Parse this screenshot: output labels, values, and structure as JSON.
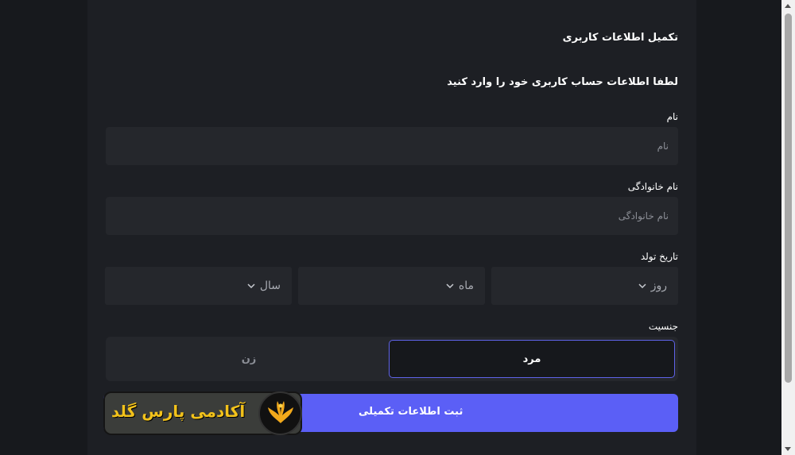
{
  "form": {
    "title": "تکمیل اطلاعات کاربری",
    "subtitle": "لطفا اطلاعات حساب کاربری خود را وارد کنید",
    "first_name": {
      "label": "نام",
      "placeholder": "نام"
    },
    "last_name": {
      "label": "نام خانوادگی",
      "placeholder": "نام خانوادگی"
    },
    "birth_date": {
      "label": "تاریخ تولد",
      "day": "روز",
      "month": "ماه",
      "year": "سال"
    },
    "gender": {
      "label": "جنسیت",
      "male": "مرد",
      "female": "زن",
      "selected": "male"
    },
    "submit_label": "ثبت اطلاعات تکمیلی"
  },
  "watermark": {
    "text": "آکادمی پارس گلد",
    "color": "#f2c21b"
  },
  "colors": {
    "accent": "#5b5ff6",
    "selected_border": "#5f63e8",
    "input_bg": "#25272c",
    "card_bg": "#1d1f24"
  }
}
